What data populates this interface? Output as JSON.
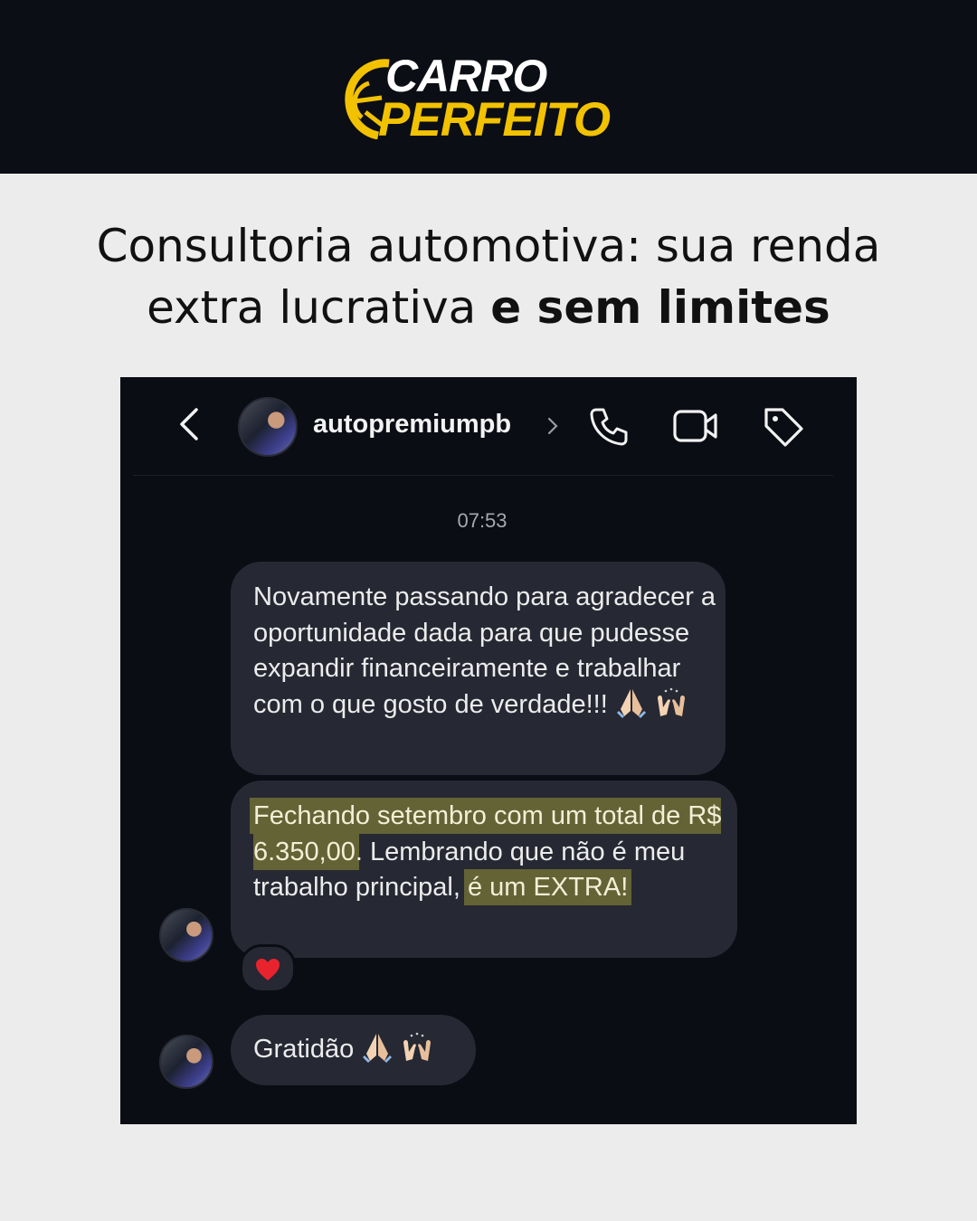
{
  "brand": {
    "line1": "CARRO",
    "line2": "PERFEITO",
    "colors": {
      "primary": "#f2c200",
      "dark": "#0b0e15"
    }
  },
  "headline": {
    "part1": "Consultoria automotiva: sua renda extra lucrativa",
    "bold": "e sem limites"
  },
  "chat": {
    "username": "autopremiumpb",
    "icons": [
      "back-arrow-icon",
      "chevron-right-icon",
      "phone-icon",
      "video-camera-icon",
      "tag-icon"
    ],
    "timestamp": "07:53",
    "messages": [
      {
        "text": "Novamente passando para agradecer a oportunidade dada para que pudesse expandir financeiramente e trabalhar com o que gosto de verdade!!!",
        "emojis": [
          "folded-hands",
          "raising-hands"
        ]
      },
      {
        "segments": [
          "Fechando setembro com um total de R$ 6.350,00",
          ". Lembrando que não é meu trabalho principal,",
          "é um EXTRA!"
        ],
        "reaction": "red-heart"
      },
      {
        "text": "Gratidão",
        "emojis": [
          "folded-hands",
          "raising-hands"
        ]
      }
    ]
  }
}
